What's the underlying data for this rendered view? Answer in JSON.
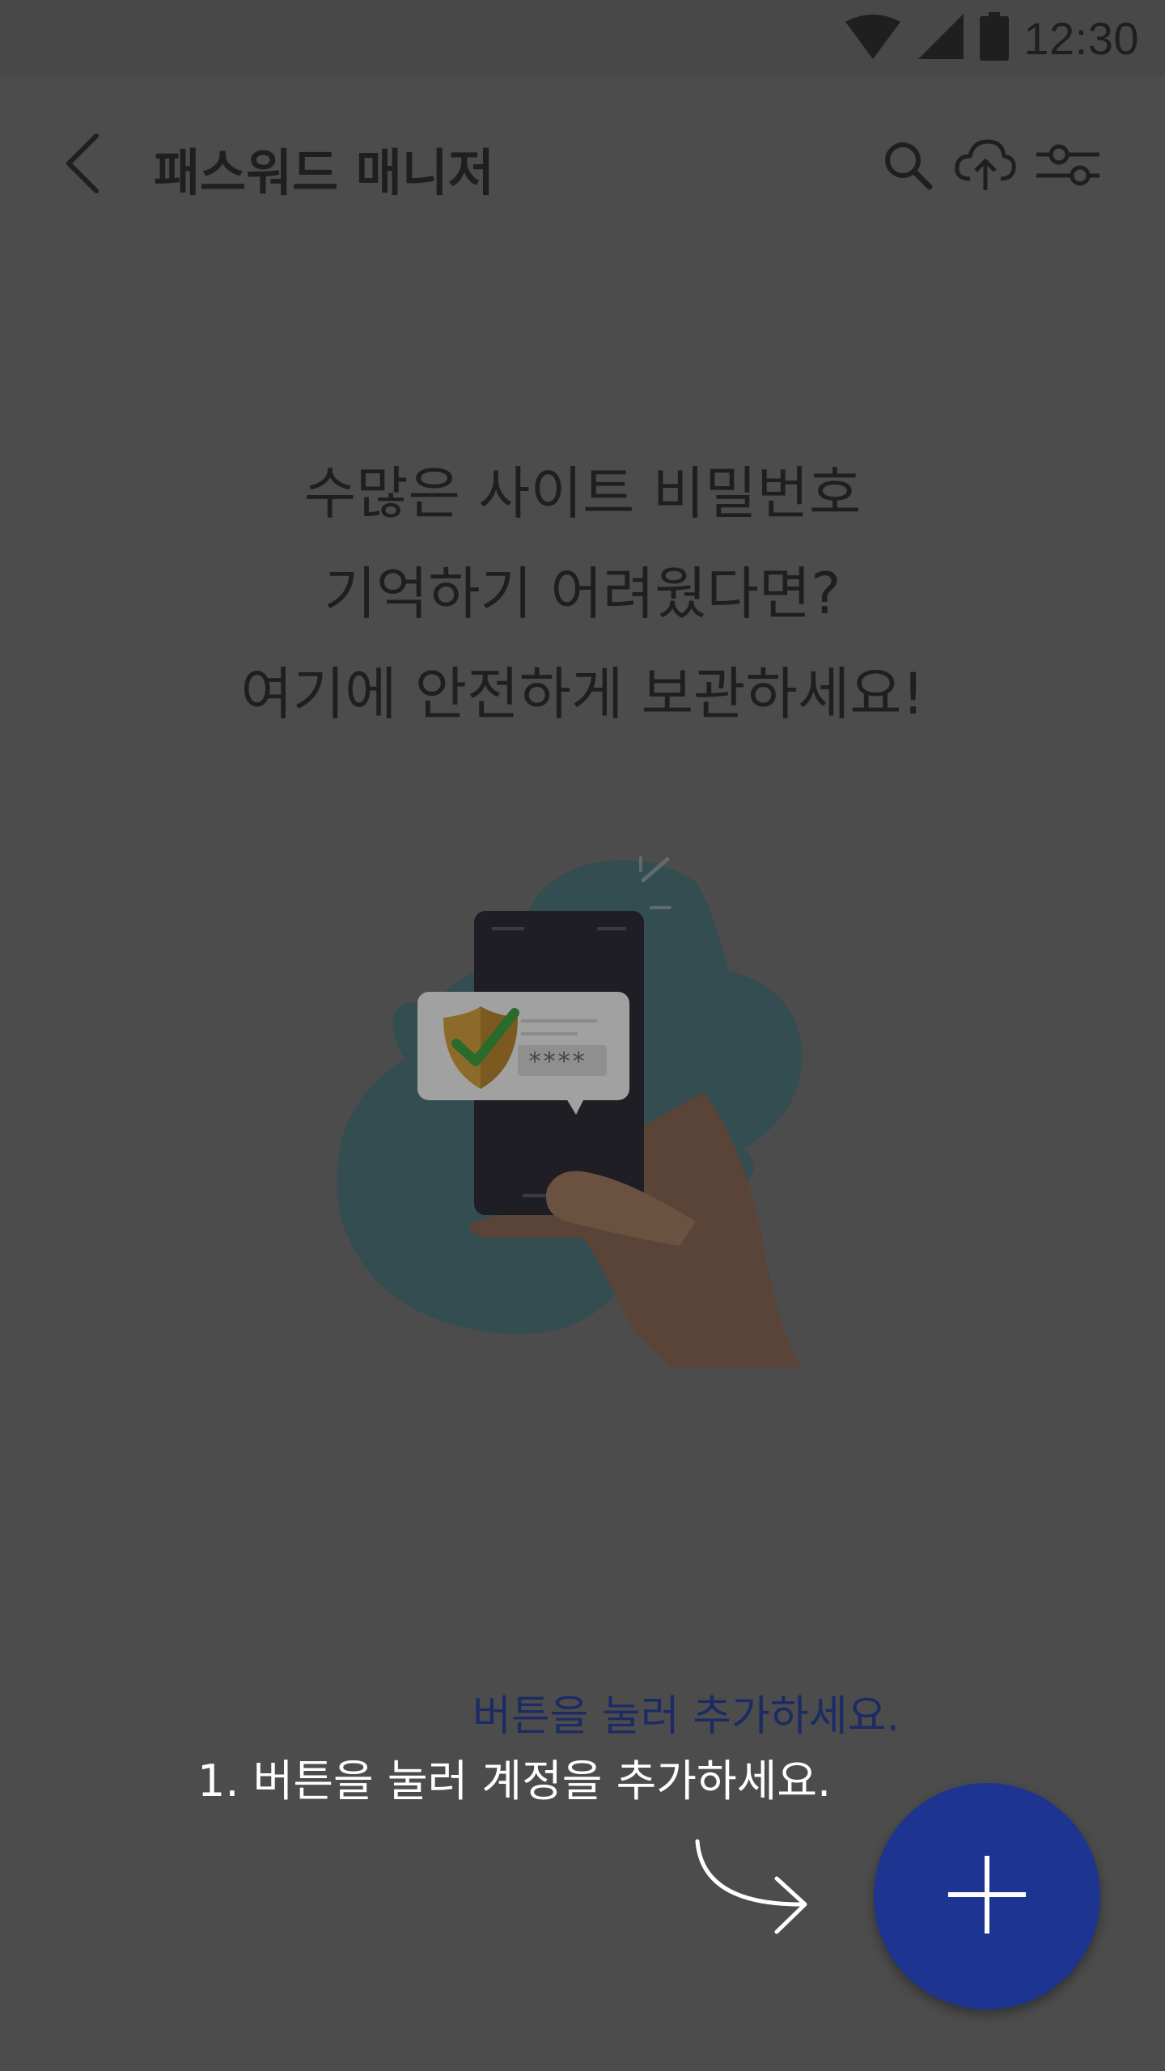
{
  "status_bar": {
    "time": "12:30",
    "icons": [
      "wifi-icon",
      "signal-icon",
      "battery-icon"
    ]
  },
  "app_bar": {
    "title": "패스워드 매니저",
    "back_icon": "back-arrow-icon",
    "actions": [
      "search-icon",
      "cloud-upload-icon",
      "filter-settings-icon"
    ]
  },
  "empty_state": {
    "line1": "수많은 사이트 비밀번호",
    "line2": "기억하기 어려웠다면?",
    "line3": "여기에 안전하게 보관하세요!",
    "illustration_password_text": "****"
  },
  "coach_mark": {
    "hint_behind": "버튼을 눌러 추가하세요.",
    "hint_overlay": "1. 버튼을 눌러 계정을 추가하세요."
  },
  "fab": {
    "icon": "plus-icon"
  },
  "colors": {
    "overlay_background": "#4c4c4c",
    "fab": "#1e3491",
    "hint_blue": "#1c2b63",
    "hint_white": "#ffffff"
  }
}
